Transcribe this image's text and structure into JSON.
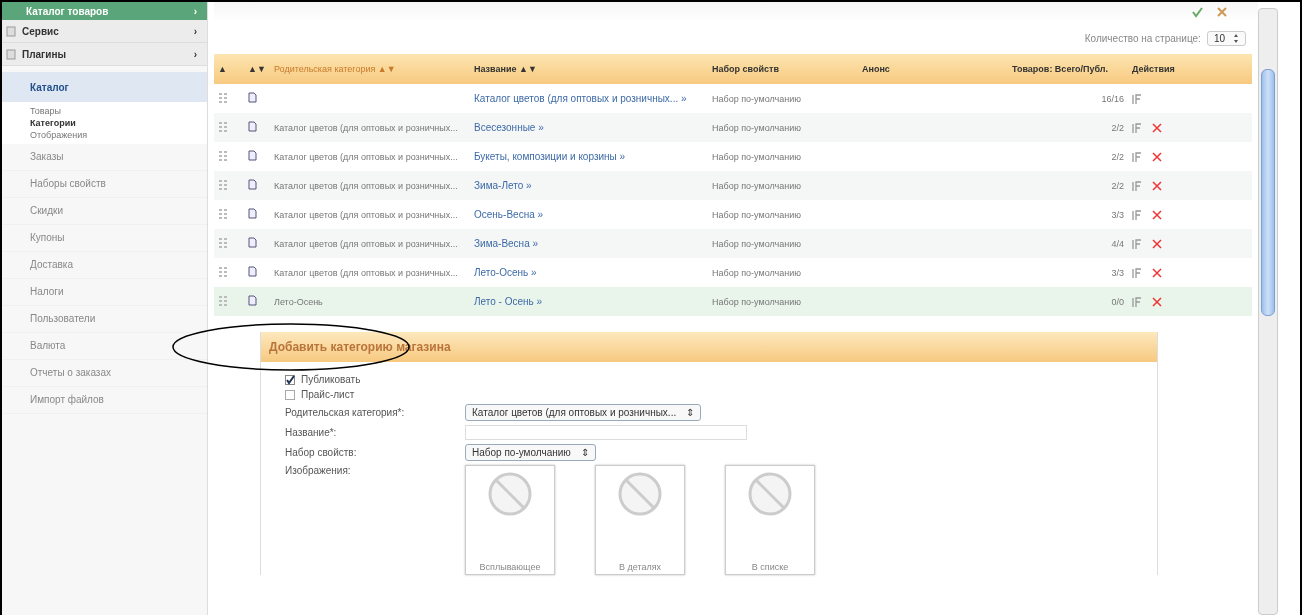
{
  "sidebar": {
    "header": {
      "label": "Каталог товаров",
      "arrow": "›"
    },
    "sections": [
      {
        "label": "Сервис",
        "arrow": "›"
      },
      {
        "label": "Плагины",
        "arrow": "›"
      }
    ],
    "group": {
      "label": "Каталог",
      "selected": true,
      "children": [
        {
          "label": "Товары",
          "selected": false
        },
        {
          "label": "Категории",
          "selected": true
        },
        {
          "label": "Отображения",
          "selected": false
        }
      ]
    },
    "items": [
      {
        "label": "Заказы"
      },
      {
        "label": "Наборы свойств"
      },
      {
        "label": "Скидки"
      },
      {
        "label": "Купоны"
      },
      {
        "label": "Доставка"
      },
      {
        "label": "Налоги"
      },
      {
        "label": "Пользователи"
      },
      {
        "label": "Валюта"
      },
      {
        "label": "Отчеты о заказах"
      },
      {
        "label": "Импорт файлов"
      }
    ]
  },
  "per_page": {
    "label": "Количество на странице:",
    "value": "10"
  },
  "table": {
    "columns": [
      {
        "sort": "▲",
        "active": false
      },
      {
        "sort": "▲▼",
        "active": false
      },
      {
        "label": "Родительская категория",
        "sort": "▲▼",
        "active": true
      },
      {
        "label": "Название",
        "sort": "▲▼",
        "active": false
      },
      {
        "label": "Набор свойств",
        "active": false
      },
      {
        "label": "Анонс",
        "active": false
      },
      {
        "label": "Товаров: Всего/Публ.",
        "active": false
      },
      {
        "label": "Действия",
        "active": false
      }
    ],
    "rows": [
      {
        "name": "Каталог цветов (для оптовых и розничных... »",
        "set": "Набор по-умолчанию",
        "count": "16/16",
        "deletable": false,
        "selected": false
      },
      {
        "parent": "Каталог цветов (для оптовых и розничных...",
        "name": "Всесезонные »",
        "set": "Набор по-умолчанию",
        "count": "2/2",
        "deletable": true,
        "selected": false
      },
      {
        "parent": "Каталог цветов (для оптовых и розничных...",
        "name": "Букеты, композиции и корзины »",
        "set": "Набор по-умолчанию",
        "count": "2/2",
        "deletable": true,
        "selected": false
      },
      {
        "parent": "Каталог цветов (для оптовых и розничных...",
        "name": "Зима-Лето »",
        "set": "Набор по-умолчанию",
        "count": "2/2",
        "deletable": true,
        "selected": false
      },
      {
        "parent": "Каталог цветов (для оптовых и розничных...",
        "name": "Осень-Весна »",
        "set": "Набор по-умолчанию",
        "count": "3/3",
        "deletable": true,
        "selected": false
      },
      {
        "parent": "Каталог цветов (для оптовых и розничных...",
        "name": "Зима-Весна »",
        "set": "Набор по-умолчанию",
        "count": "4/4",
        "deletable": true,
        "selected": false
      },
      {
        "parent": "Каталог цветов (для оптовых и розничных...",
        "name": "Лето-Осень »",
        "set": "Набор по-умолчанию",
        "count": "3/3",
        "deletable": true,
        "selected": false
      },
      {
        "parent": "Лето-Осень",
        "name": "Лето - Осень »",
        "set": "Набор по-умолчанию",
        "count": "0/0",
        "deletable": true,
        "selected": true
      }
    ]
  },
  "form": {
    "title": "Добавить категорию магазина",
    "checkboxes": [
      {
        "label": "Публиковать",
        "checked": true
      },
      {
        "label": "Прайс-лист",
        "checked": false
      }
    ],
    "fields": [
      {
        "kind": "select",
        "label": "Родительская категория*:",
        "value": "Каталог цветов (для оптовых и розничных...",
        "arrow": "⇕"
      },
      {
        "kind": "input",
        "label": "Название*:"
      },
      {
        "kind": "select",
        "label": "Набор свойств:",
        "value": "Набор по-умолчанию",
        "arrow": "⇕"
      }
    ],
    "images": {
      "label": "Изображения:",
      "slots": [
        {
          "caption": "Всплывающее"
        },
        {
          "caption": "В деталях"
        },
        {
          "caption": "В списке"
        }
      ]
    }
  }
}
